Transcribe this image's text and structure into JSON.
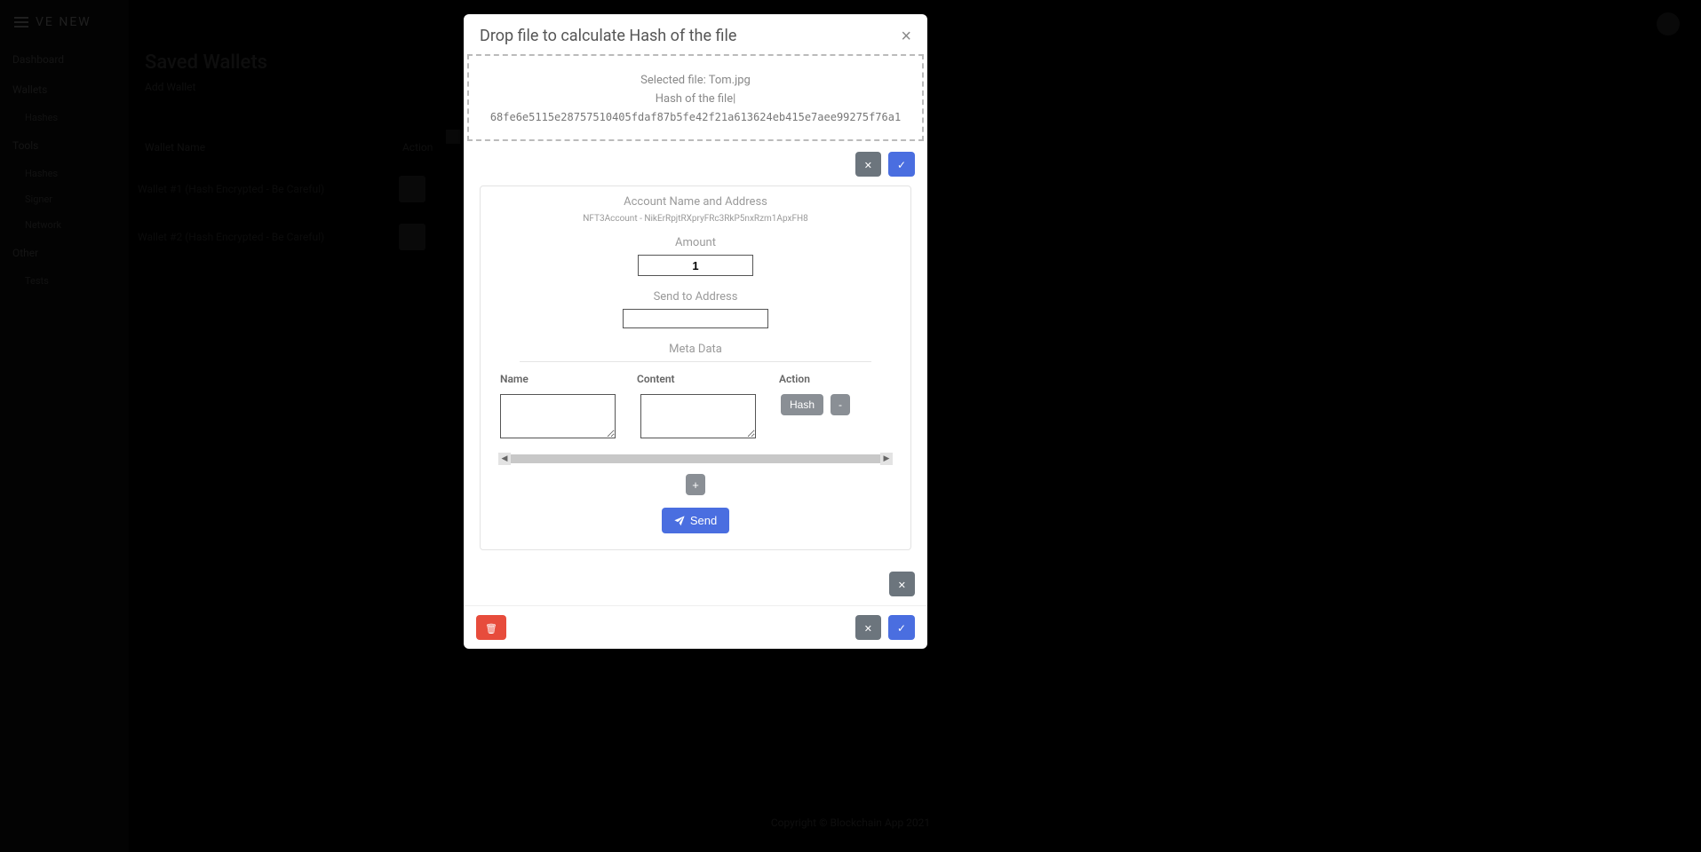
{
  "app": {
    "brand": "VE NEW",
    "nav": {
      "dashboard": "Dashboard",
      "wallets": "Wallets",
      "wallets_sub": "Hashes",
      "tools": "Tools",
      "tools_sub1": "Hashes",
      "tools_sub2": "Signer",
      "tools_sub3": "Network",
      "other": "Other",
      "other_sub": "Tests"
    }
  },
  "page": {
    "title": "Saved Wallets",
    "addLabel": "Add Wallet",
    "cols": {
      "name": "Wallet Name",
      "action": "Action"
    },
    "rows": [
      {
        "name": "Wallet #1 (Hash Encrypted - Be Careful)"
      },
      {
        "name": "Wallet #2 (Hash Encrypted - Be Careful)"
      }
    ]
  },
  "footer": "Copyright © Blockchain App 2021",
  "modal": {
    "title": "Drop file to calculate Hash of the file",
    "drop": {
      "selectedPrefix": "Selected file: ",
      "selectedFile": "Tom.jpg",
      "hashLabel": "Hash of the file|",
      "hashValue": "68fe6e5115e28757510405fdaf87b5fe42f21a613624eb415e7aee99275f76a1"
    },
    "form": {
      "accountLabel": "Account Name and Address",
      "accountLine": "NFT3Account - NikErRpjtRXpryFRc3RkP5nxRzm1ApxFH8",
      "amountLabel": "Amount",
      "amountValue": "1",
      "sendToLabel": "Send to Address",
      "sendToValue": "",
      "metaLabel": "Meta Data",
      "cols": {
        "name": "Name",
        "content": "Content",
        "action": "Action"
      },
      "row": {
        "name": "",
        "content": "",
        "hashBtn": "Hash",
        "minus": "-"
      },
      "plus": "+",
      "sendBtn": "Send"
    }
  },
  "colors": {
    "primary": "#4a6ee0",
    "danger": "#e74c3c",
    "muted": "#8a8f95"
  }
}
